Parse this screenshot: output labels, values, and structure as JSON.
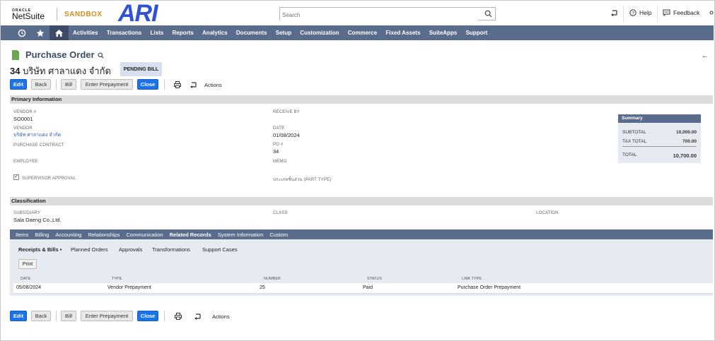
{
  "header": {
    "oracle_label": "ORACLE",
    "netsuite_label": "NetSuite",
    "environment": "SANDBOX",
    "company_logo_text": "ARI",
    "search_placeholder": "Search",
    "help_label": "Help",
    "feedback_label": "Feedback"
  },
  "nav": {
    "items": [
      "Activities",
      "Transactions",
      "Lists",
      "Reports",
      "Analytics",
      "Documents",
      "Setup",
      "Customization",
      "Commerce",
      "Fixed Assets",
      "SuiteApps",
      "Support"
    ]
  },
  "record": {
    "type_title": "Purchase Order",
    "number": "34",
    "vendor_name": "บริษัท ศาลาแดง จำกัด",
    "status": "PENDING BILL"
  },
  "buttons": {
    "edit": "Edit",
    "back": "Back",
    "bill": "Bill",
    "enter_prepayment": "Enter Prepayment",
    "close": "Close",
    "actions": "Actions"
  },
  "primary": {
    "section_title": "Primary Information",
    "vendor_no_label": "VENDOR #",
    "vendor_no_value": "SO0001",
    "vendor_label": "VENDOR",
    "vendor_value": "บริษัท ศาลาแดง จำกัด",
    "purchase_contract_label": "PURCHASE CONTRACT",
    "employee_label": "EMPLOYEE",
    "supervisor_approval_label": "SUPERVISOR APPROVAL",
    "supervisor_approval_checked": true,
    "receive_by_label": "RECEIVE BY",
    "date_label": "DATE",
    "date_value": "01/08/2024",
    "po_label": "PO #",
    "po_value": "34",
    "memo_label": "MEMO",
    "part_type_label": "ประเภทชิ้นส่วน (PART TYPE)"
  },
  "summary": {
    "title": "Summary",
    "subtotal_label": "SUBTOTAL",
    "subtotal_value": "10,000.00",
    "tax_label": "TAX TOTAL",
    "tax_value": "700.00",
    "total_label": "TOTAL",
    "total_value": "10,700.00"
  },
  "classification": {
    "section_title": "Classification",
    "subsidiary_label": "SUBSIDIARY",
    "subsidiary_value": "Sala Daeng Co.,Ltd.",
    "class_label": "CLASS",
    "location_label": "LOCATION"
  },
  "tabs": {
    "items": [
      "Items",
      "Billing",
      "Accounting",
      "Relationships",
      "Communication",
      "Related Records",
      "System Information",
      "Custom"
    ],
    "active": "Related Records"
  },
  "subtabs": {
    "items": [
      "Receipts & Bills •",
      "Planned Orders",
      "Approvals",
      "Transformations",
      "Support Cases"
    ],
    "active": "Receipts & Bills •"
  },
  "related_grid": {
    "print_label": "Print",
    "columns": [
      "DATE",
      "TYPE",
      "NUMBER",
      "STATUS",
      "LINK TYPE"
    ],
    "rows": [
      {
        "date": "05/08/2024",
        "type": "Vendor Prepayment",
        "number": "25",
        "status": "Paid",
        "link_type": "Purchase Order Prepayment"
      }
    ]
  },
  "colors": {
    "nav_bg": "#5a6c8c",
    "primary_button": "#1a73e8",
    "sandbox_accent": "#d98c1e",
    "logo_blue": "#2f52d6"
  }
}
